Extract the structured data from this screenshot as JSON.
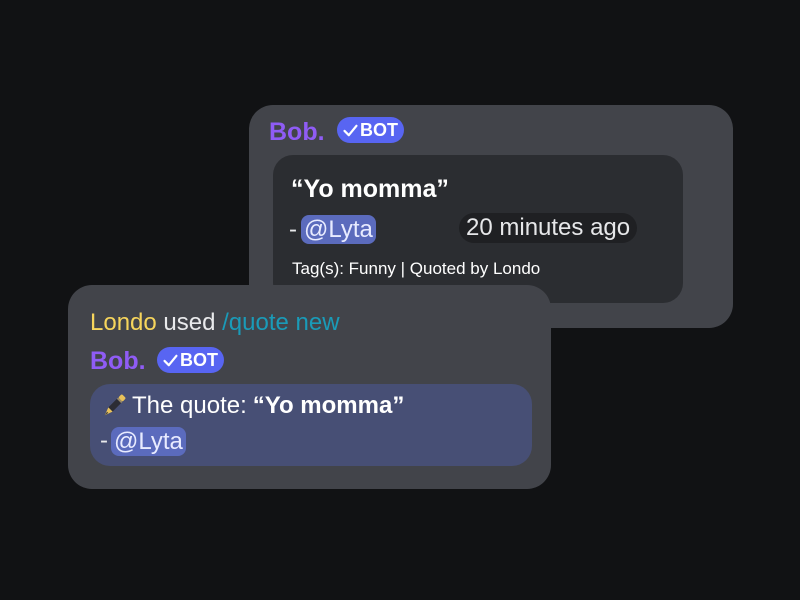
{
  "quote_card": {
    "bot_name": "Bob.",
    "badge_label": "BOT",
    "quote": "“Yo momma”",
    "dash": "-",
    "mention": "@Lyta",
    "timestamp": "20 minutes ago",
    "footer": "Tag(s): Funny | Quoted by Londo"
  },
  "command_card": {
    "user": "Londo",
    "used": "used",
    "command": "/quote new",
    "bot_name": "Bob.",
    "badge_label": "BOT",
    "reply_prefix": "The quote:",
    "reply_quote": "“Yo momma”",
    "dash": "-",
    "mention": "@Lyta",
    "pen_icon": "pen-icon"
  }
}
